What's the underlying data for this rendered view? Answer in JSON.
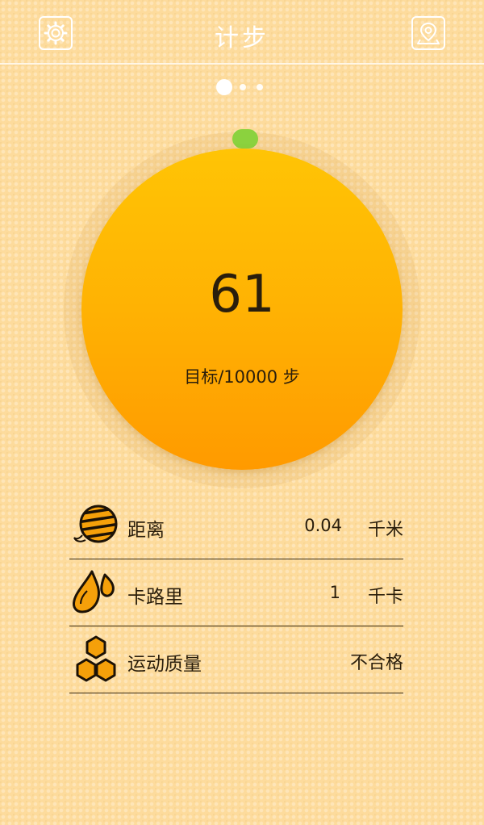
{
  "header": {
    "title": "计步",
    "left_icon": "settings-icon",
    "right_icon": "location-icon"
  },
  "pager": {
    "count": 3,
    "active": 1
  },
  "progress": {
    "steps": "61",
    "goal_text": "目标/10000 步",
    "fraction": 0.0061
  },
  "stats": {
    "distance": {
      "icon": "yarn-ball-icon",
      "label": "距离",
      "value": "0.04",
      "unit": "千米"
    },
    "calories": {
      "icon": "drops-icon",
      "label": "卡路里",
      "value": "1",
      "unit": "千卡"
    },
    "quality": {
      "icon": "honeycomb-icon",
      "label": "运动质量",
      "value": "不合格"
    }
  },
  "colors": {
    "background": "#fddb9c",
    "circle_top": "#ffc405",
    "circle_bottom": "#ff9a00",
    "knob": "#8bd23e",
    "text": "#2a1e0c"
  }
}
